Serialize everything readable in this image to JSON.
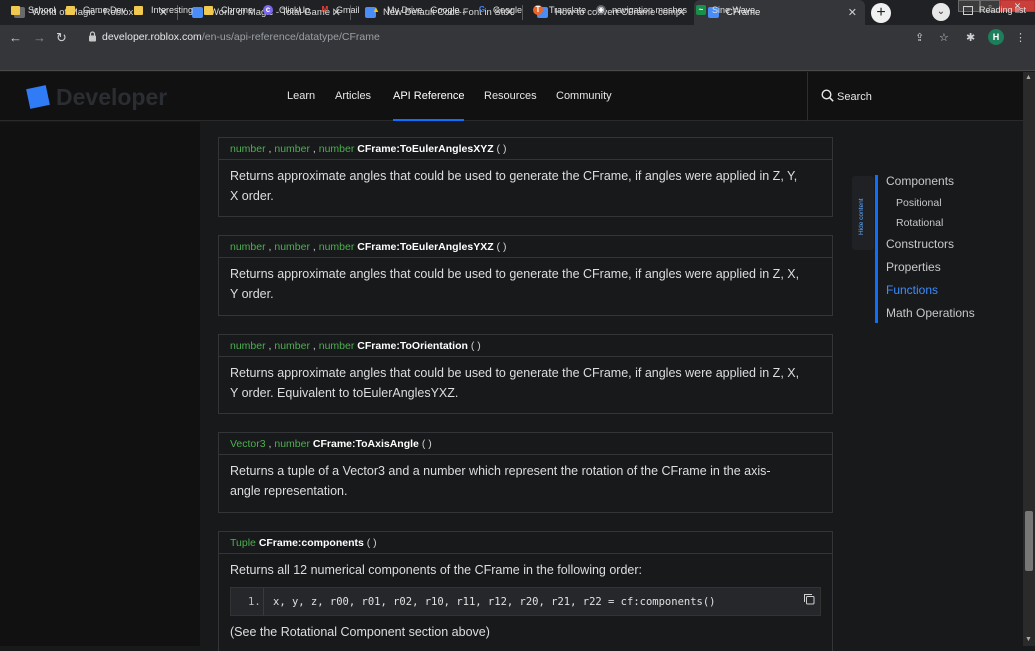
{
  "browser": {
    "tabs": [
      {
        "title": "World of Magic - Roblox",
        "favicon_color": "#6b6b6b"
      },
      {
        "title": "World of Magic - Total Game Rev",
        "favicon_color": "#4a8df6"
      },
      {
        "title": "New Default Code Font in Studio",
        "favicon_color": "#4a8df6"
      },
      {
        "title": "How to convert CFrame compon",
        "favicon_color": "#4a8df6"
      },
      {
        "title": "CFrame",
        "favicon_color": "#4a8df6"
      }
    ],
    "new_tab_glyph": "+",
    "url_host": "developer.roblox.com",
    "url_path": "/en-us/api-reference/datatype/CFrame",
    "avatar_letter": "H",
    "reading_list_label": "Reading list",
    "bookmarks": [
      {
        "label": "School",
        "kind": "folder"
      },
      {
        "label": "Game Dev",
        "kind": "folder"
      },
      {
        "label": "Interesting",
        "kind": "folder"
      },
      {
        "label": "Chrome",
        "kind": "folder"
      },
      {
        "label": "ClickUp",
        "kind": "clickup"
      },
      {
        "label": "Gmail",
        "kind": "gmail"
      },
      {
        "label": "My Drive - Google...",
        "kind": "drive"
      },
      {
        "label": "Google",
        "kind": "google"
      },
      {
        "label": "Translate",
        "kind": "translate"
      },
      {
        "label": "navigation meshes",
        "kind": "globe"
      },
      {
        "label": "Sine Wave",
        "kind": "sine"
      }
    ]
  },
  "site": {
    "logo_text": "Developer",
    "nav": [
      "Learn",
      "Articles",
      "API Reference",
      "Resources",
      "Community"
    ],
    "active_nav": "API Reference",
    "search_label": "Search",
    "accent": "#0e6fff",
    "type_color": "#4caf50"
  },
  "functions": [
    {
      "returns": [
        "number",
        "number",
        "number"
      ],
      "name": "CFrame:ToEulerAnglesXYZ",
      "parens": "( )",
      "desc_lines": [
        "Returns approximate angles that could be used to generate the CFrame, if angles were applied in Z, Y,",
        "X order."
      ]
    },
    {
      "returns": [
        "number",
        "number",
        "number"
      ],
      "name": "CFrame:ToEulerAnglesYXZ",
      "parens": "( )",
      "desc_lines": [
        "Returns approximate angles that could be used to generate the CFrame, if angles were applied in Z, X,",
        "Y order."
      ]
    },
    {
      "returns": [
        "number",
        "number",
        "number"
      ],
      "name": "CFrame:ToOrientation",
      "parens": "( )",
      "desc_lines": [
        "Returns approximate angles that could be used to generate the CFrame, if angles were applied in Z, X,",
        "Y order. Equivalent to toEulerAnglesYXZ."
      ]
    },
    {
      "returns": [
        "Vector3",
        "number"
      ],
      "name": "CFrame:ToAxisAngle",
      "parens": "( )",
      "desc_lines": [
        "Returns a tuple of a Vector3 and a number which represent the rotation of the CFrame in the axis-",
        "angle representation."
      ]
    },
    {
      "returns": [
        "Tuple"
      ],
      "name": "CFrame:components",
      "parens": "( )",
      "desc_lines": [
        "Returns all 12 numerical components of the CFrame in the following order:"
      ]
    }
  ],
  "code": {
    "line_number": "1.",
    "text": "x, y, z, r00, r01, r02, r10, r11, r12, r20, r21, r22 = cf:components()"
  },
  "after_code": "(See the Rotational Component section above)",
  "toc": {
    "hide_label": "Hide content",
    "items": [
      {
        "label": "Components",
        "sub": false,
        "active": false
      },
      {
        "label": "Positional",
        "sub": true,
        "active": false
      },
      {
        "label": "Rotational",
        "sub": true,
        "active": false
      },
      {
        "label": "Constructors",
        "sub": false,
        "active": false
      },
      {
        "label": "Properties",
        "sub": false,
        "active": false
      },
      {
        "label": "Functions",
        "sub": false,
        "active": true
      },
      {
        "label": "Math Operations",
        "sub": false,
        "active": false
      }
    ]
  }
}
